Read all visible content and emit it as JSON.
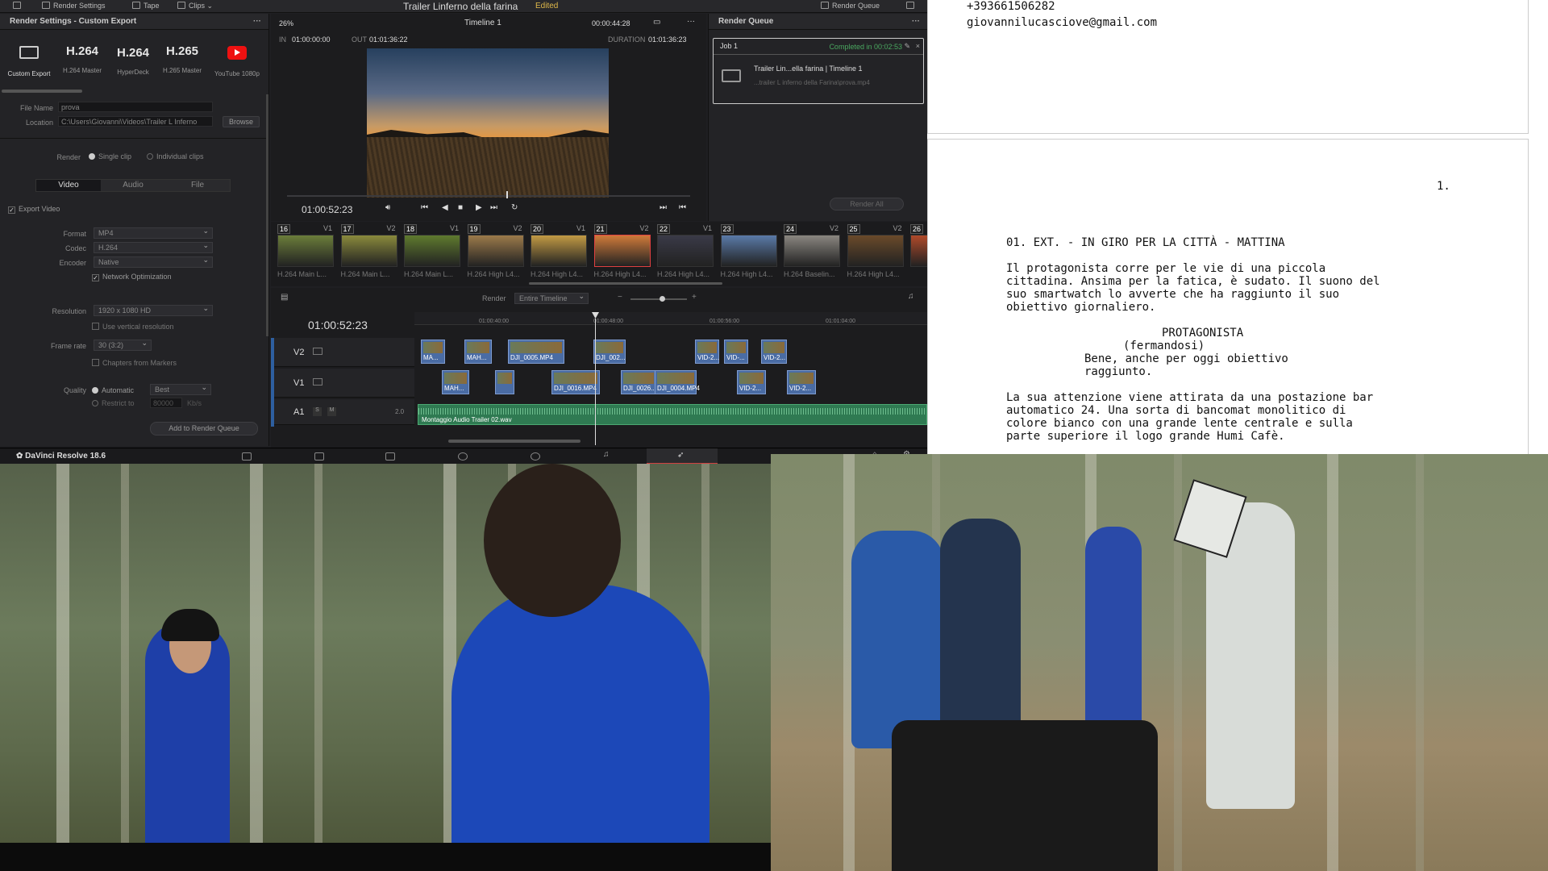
{
  "app": {
    "name": "DaVinci Resolve 18.6",
    "project_title": "Trailer Linferno della farina",
    "edited_label": "Edited",
    "top_tabs": [
      "Render Settings",
      "Tape",
      "Clips"
    ],
    "render_queue_tab": "Render Queue"
  },
  "render_settings": {
    "header": "Render Settings - Custom Export",
    "presets": [
      {
        "big": "",
        "label": "Custom Export"
      },
      {
        "big": "H.264",
        "label": "H.264 Master"
      },
      {
        "big": "H.264",
        "label": "HyperDeck"
      },
      {
        "big": "H.265",
        "label": "H.265 Master"
      },
      {
        "big": "",
        "label": "YouTube 1080p"
      }
    ],
    "file_name_label": "File Name",
    "file_name": "prova",
    "location_label": "Location",
    "location": "C:\\Users\\Giovanni\\Videos\\Trailer L Inferno",
    "browse": "Browse",
    "render_label": "Render",
    "single_clip": "Single clip",
    "individual_clips": "Individual clips",
    "tabs": [
      "Video",
      "Audio",
      "File"
    ],
    "export_video": "Export Video",
    "format_label": "Format",
    "format": "MP4",
    "codec_label": "Codec",
    "codec": "H.264",
    "encoder_label": "Encoder",
    "encoder": "Native",
    "network_opt": "Network Optimization",
    "resolution_label": "Resolution",
    "resolution": "1920 x 1080 HD",
    "vertical_res": "Use vertical resolution",
    "frame_rate_label": "Frame rate",
    "frame_rate": "30 (3:2)",
    "chapters": "Chapters from Markers",
    "quality_label": "Quality",
    "automatic": "Automatic",
    "quality": "Best",
    "restrict_to": "Restrict to",
    "restrict_value": "80000",
    "restrict_unit": "Kb/s",
    "add_to_queue": "Add to Render Queue"
  },
  "viewer": {
    "zoom": "26%",
    "timeline_name": "Timeline 1",
    "timecode_top": "00:00:44:28",
    "in_label": "IN",
    "in_tc": "01:00:00:00",
    "out_label": "OUT",
    "out_tc": "01:01:36:22",
    "duration_label": "DURATION",
    "duration": "01:01:36:23",
    "current_tc": "01:00:52:23"
  },
  "render_queue": {
    "header": "Render Queue",
    "job_name": "Job 1",
    "job_status": "Completed in 00:02:53",
    "job_title": "Trailer Lin...ella farina | Timeline 1",
    "job_path": "...trailer L inferno della Farina\\prova.mp4",
    "render_all": "Render All"
  },
  "clips": [
    {
      "num": "16",
      "track": "V1",
      "label": "H.264 Main L...",
      "color": "#6b7d3a"
    },
    {
      "num": "17",
      "track": "V2",
      "label": "H.264 Main L...",
      "color": "#8a8a3c"
    },
    {
      "num": "18",
      "track": "V1",
      "label": "H.264 Main L...",
      "color": "#5f7a2e"
    },
    {
      "num": "19",
      "track": "V2",
      "label": "H.264 High L4...",
      "color": "#9c7a4a"
    },
    {
      "num": "20",
      "track": "V1",
      "label": "H.264 High L4...",
      "color": "#c29a44"
    },
    {
      "num": "21",
      "track": "V2",
      "label": "H.264 High L4...",
      "color": "#d07a3a"
    },
    {
      "num": "22",
      "track": "V1",
      "label": "H.264 High L4...",
      "color": "#3a3a48"
    },
    {
      "num": "23",
      "track": "",
      "label": "H.264 High L4...",
      "color": "#5a7aa8"
    },
    {
      "num": "24",
      "track": "V2",
      "label": "H.264 Baselin...",
      "color": "#8a8680"
    },
    {
      "num": "25",
      "track": "V2",
      "label": "H.264 High L4...",
      "color": "#6a4a2a"
    },
    {
      "num": "26",
      "track": "",
      "label": "",
      "color": "#b04a2a"
    }
  ],
  "timeline": {
    "render_label": "Render",
    "render_mode": "Entire Timeline",
    "current_tc": "01:00:52:23",
    "ruler": [
      "01:00:40:00",
      "01:00:48:00",
      "01:00:56:00",
      "01:01:04:00"
    ],
    "tracks": {
      "v2": "V2",
      "v1": "V1",
      "a1": "A1"
    },
    "audio_volume": "2.0",
    "audio_clip": "Montaggio Audio Trailer 02.wav",
    "v2_clips": [
      "MA...",
      "MAH...",
      "DJI_0005.MP4",
      "DJI_002...",
      "VID-2...",
      "VID-...",
      "VID-2..."
    ],
    "v1_clips": [
      "MAH...",
      "",
      "DJI_0016.MP4",
      "DJI_0026...",
      "DJI_0004.MP4",
      "VID-2...",
      "VID-2..."
    ]
  },
  "screenplay": {
    "phone": "+393661506282",
    "email": "giovannilucasciove@gmail.com",
    "page_number": "1.",
    "scene_heading": "01. EXT. - IN GIRO PER LA CITTÀ - MATTINA",
    "action_1": [
      "Il protagonista corre per le vie di una piccola",
      "cittadina. Ansima per la fatica, è sudato. Il suono del",
      "suo smartwatch lo avverte che ha raggiunto il suo",
      "obiettivo giornaliero."
    ],
    "character": "PROTAGONISTA",
    "parenthetical": "(fermandosi)",
    "dialogue": [
      "Bene, anche per oggi obiettivo",
      "raggiunto."
    ],
    "action_2": [
      "La sua attenzione viene attirata da una postazione bar",
      "automatico 24. Una sorta di bancomat monolitico di",
      "colore bianco con una grande lente centrale e sulla",
      "parte superiore il logo grande Humi Cafè."
    ]
  }
}
